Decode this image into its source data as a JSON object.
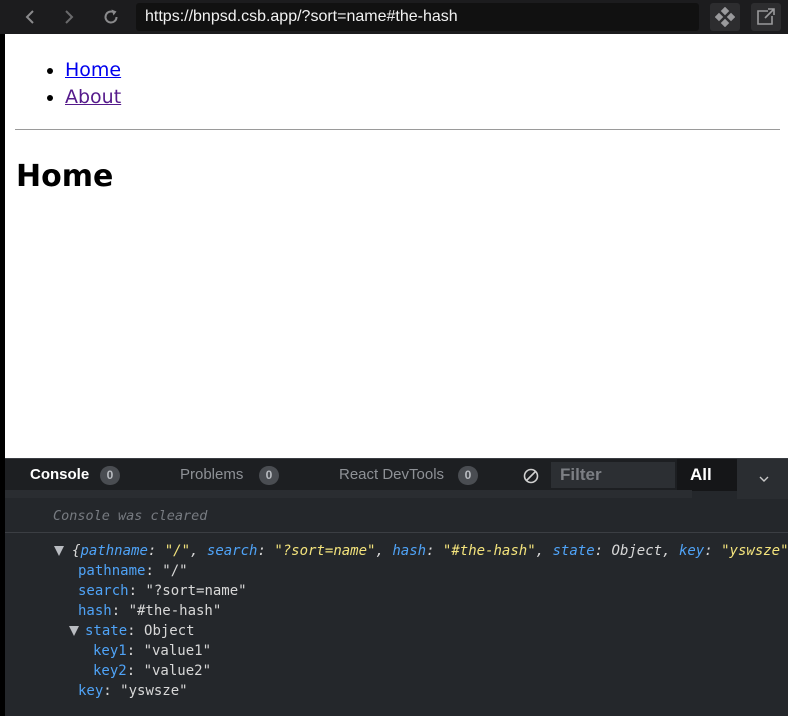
{
  "browser": {
    "url": "https://bnpsd.csb.app/?sort=name#the-hash"
  },
  "page": {
    "nav_links": [
      "Home",
      "About"
    ],
    "heading": "Home"
  },
  "devtools": {
    "tabs": [
      {
        "label": "Console",
        "count": "0"
      },
      {
        "label": "Problems",
        "count": "0"
      },
      {
        "label": "React DevTools",
        "count": "0"
      }
    ],
    "filter_placeholder": "Filter",
    "level": "All",
    "console": {
      "cleared_message": "Console was cleared",
      "summary": {
        "open": "{",
        "close": "}",
        "entries": [
          {
            "key": "pathname",
            "value": "\"/\""
          },
          {
            "key": "search",
            "value": "\"?sort=name\""
          },
          {
            "key": "hash",
            "value": "\"#the-hash\""
          },
          {
            "key": "state",
            "value": "Object"
          },
          {
            "key": "key",
            "value": "\"yswsze\""
          }
        ]
      },
      "properties": [
        {
          "key": "pathname",
          "value": "\"/\""
        },
        {
          "key": "search",
          "value": "\"?sort=name\""
        },
        {
          "key": "hash",
          "value": "\"#the-hash\""
        }
      ],
      "state": {
        "key": "state",
        "value": "Object",
        "children": [
          {
            "key": "key1",
            "value": "\"value1\""
          },
          {
            "key": "key2",
            "value": "\"value2\""
          }
        ]
      },
      "last_property": {
        "key": "key",
        "value": "\"yswsze\""
      }
    }
  }
}
